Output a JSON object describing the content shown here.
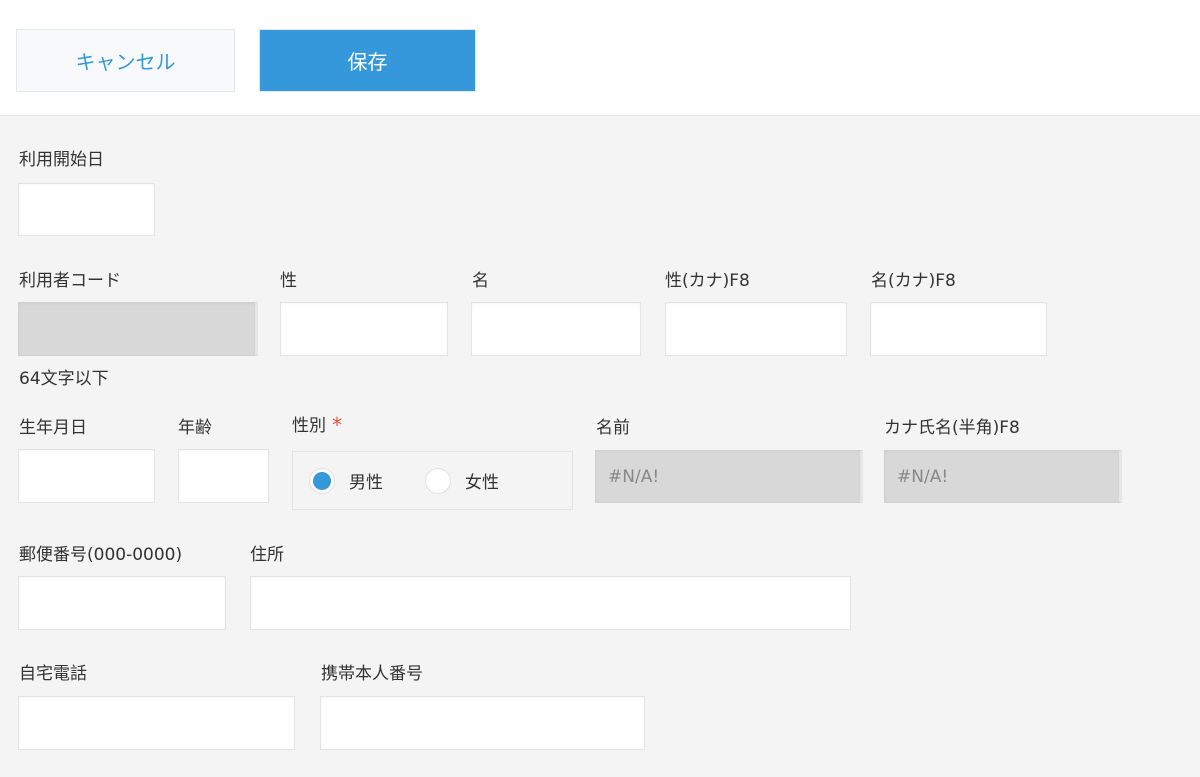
{
  "toolbar": {
    "cancel_label": "キャンセル",
    "save_label": "保存"
  },
  "form": {
    "start_date": {
      "label": "利用開始日",
      "value": ""
    },
    "user_code": {
      "label": "利用者コード",
      "value": "",
      "note": "64文字以下"
    },
    "last_name": {
      "label": "性",
      "value": ""
    },
    "first_name": {
      "label": "名",
      "value": ""
    },
    "last_name_kana": {
      "label": "性(カナ)F8",
      "value": ""
    },
    "first_name_kana": {
      "label": "名(カナ)F8",
      "value": ""
    },
    "birth_date": {
      "label": "生年月日",
      "value": ""
    },
    "age": {
      "label": "年齢",
      "value": ""
    },
    "gender": {
      "label": "性別",
      "required_mark": "*",
      "options": [
        {
          "label": "男性",
          "selected": true
        },
        {
          "label": "女性",
          "selected": false
        }
      ]
    },
    "full_name": {
      "label": "名前",
      "value": "#N/A!"
    },
    "kana_full_name": {
      "label": "カナ氏名(半角)F8",
      "value": "#N/A!"
    },
    "postal_code": {
      "label": "郵便番号(000-0000)",
      "value": ""
    },
    "address": {
      "label": "住所",
      "value": ""
    },
    "home_phone": {
      "label": "自宅電話",
      "value": ""
    },
    "mobile_phone": {
      "label": "携帯本人番号",
      "value": ""
    }
  },
  "colors": {
    "accent": "#3498db",
    "required": "#e74c3c",
    "readonly_bg": "#d8d8d8",
    "page_bg": "#f4f4f4"
  }
}
